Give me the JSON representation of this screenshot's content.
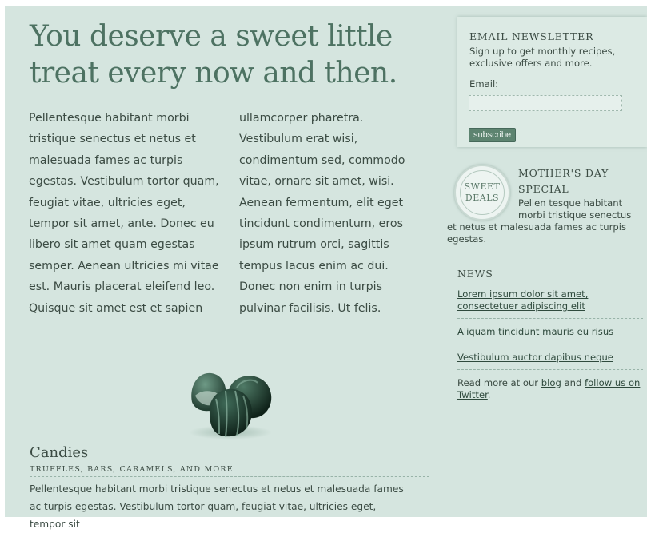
{
  "main": {
    "headline": "You deserve a sweet little treat every now and then.",
    "col1": "Pellentesque habitant morbi tristique senectus et netus et malesuada fames ac turpis egestas. Vestibulum tortor quam, feugiat vitae, ultricies eget, tempor sit amet, ante. Donec eu libero sit amet quam egestas semper. Aenean ultricies mi vitae est. Mauris placerat eleifend leo. Quisque sit amet est et sapien",
    "col2": "ullamcorper pharetra. Vestibulum erat wisi, condimentum sed, commodo vitae, ornare sit amet, wisi. Aenean fermentum, elit eget tincidunt condimentum, eros ipsum rutrum orci, sagittis tempus lacus enim ac dui. Donec non enim in turpis pulvinar facilisis. Ut felis."
  },
  "candies": {
    "title": "Candies",
    "subtitle": "TRUFFLES, BARS, CARAMELS, AND MORE",
    "text": "Pellentesque habitant morbi tristique senectus et netus et malesuada fames ac turpis egestas. Vestibulum tortor quam, feugiat vitae, ultricies eget, tempor sit"
  },
  "newsletter": {
    "title": "EMAIL NEWSLETTER",
    "description": "Sign up to get monthly recipes, exclusive offers and more.",
    "email_label": "Email:",
    "email_value": "",
    "button_label": "subscribe"
  },
  "special": {
    "badge_line1": "SWEET",
    "badge_line2": "DEALS",
    "title": "MOTHER'S DAY SPECIAL",
    "text_part1": "Pellen tesque habitant morbi tristique senectus",
    "text_part2": "et netus et malesuada fames ac turpis egestas."
  },
  "news": {
    "title": "NEWS",
    "items": [
      "Lorem ipsum dolor sit amet, consectetuer adipiscing elit",
      "Aliquam tincidunt mauris eu risus",
      "Vestibulum auctor dapibus neque"
    ],
    "footer_prefix": "Read more at our",
    "blog_link": "blog",
    "footer_and": "and",
    "twitter_link": "follow us on Twitter",
    "footer_suffix": "."
  },
  "colors": {
    "background": "#d5e5df",
    "headline": "#4d7262",
    "button": "#5d8470"
  }
}
